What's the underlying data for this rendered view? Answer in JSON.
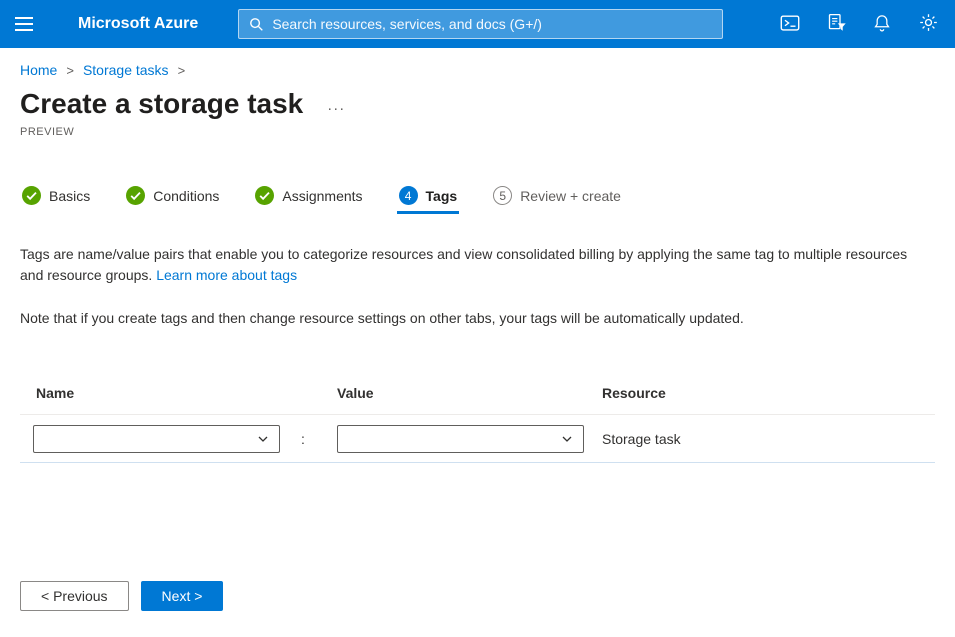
{
  "colors": {
    "topbar": "#0078d4",
    "accent": "#0078d4",
    "success_green": "#57a300",
    "muted_text": "#605e5c"
  },
  "topbar": {
    "product_title": "Microsoft Azure",
    "search": {
      "placeholder": "Search resources, services, and docs (G+/)"
    },
    "icon_names": [
      "hamburger-menu",
      "search",
      "cloud-shell",
      "directory-filter",
      "notifications-bell",
      "settings-gear"
    ]
  },
  "breadcrumb": {
    "items": [
      "Home",
      "Storage tasks"
    ],
    "separator": ">"
  },
  "page": {
    "title": "Create a storage task",
    "context_menu": "···",
    "preview_badge": "PREVIEW"
  },
  "tabs": [
    {
      "label": "Basics",
      "state": "complete"
    },
    {
      "label": "Conditions",
      "state": "complete"
    },
    {
      "label": "Assignments",
      "state": "complete"
    },
    {
      "label": "Tags",
      "state": "current",
      "step": "4"
    },
    {
      "label": "Review + create",
      "state": "upcoming",
      "step": "5"
    }
  ],
  "content": {
    "intro": "Tags are name/value pairs that enable you to categorize resources and view consolidated billing by applying the same tag to multiple resources and resource groups. ",
    "learn_more_link": "Learn more about tags",
    "note": "Note that if you create tags and then change resource settings on other tabs, your tags will be automatically updated."
  },
  "table": {
    "columns": [
      "Name",
      "Value",
      "Resource"
    ],
    "separator": ":",
    "rows": [
      {
        "name": "",
        "value": "",
        "resource": "Storage task"
      }
    ]
  },
  "footer": {
    "previous": "< Previous",
    "next": "Next >"
  }
}
